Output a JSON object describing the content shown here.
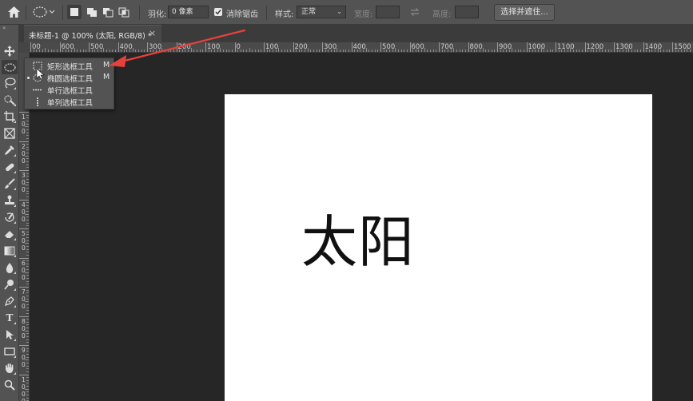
{
  "options_bar": {
    "feather_label": "羽化:",
    "feather_value": "0 像素",
    "antialias_label": "消除锯齿",
    "style_label": "样式:",
    "style_value": "正常",
    "width_label": "宽度:",
    "height_label": "高度:",
    "select_mask_label": "选择并遮住..."
  },
  "document_tab": {
    "title": "未标题-1 @ 100% (太阳, RGB/8) *",
    "close": "×"
  },
  "ruler": {
    "h_labels": [
      "00",
      "600",
      "500",
      "400",
      "300",
      "200",
      "100",
      "0",
      "100",
      "200",
      "300",
      "400",
      "500",
      "600",
      "700",
      "800",
      "900",
      "1000",
      "1100",
      "1200",
      "1300",
      "1400",
      "1500",
      "16"
    ],
    "v_labels": [
      "1\n0\n0",
      "2\n0\n0",
      "3\n0\n0",
      "4\n0\n0",
      "5\n0\n0",
      "6\n0\n0",
      "7\n0\n0",
      "8\n0\n0",
      "9\n0\n0",
      "1\n0\n0\n0"
    ]
  },
  "canvas": {
    "text": "太阳",
    "artboard_color": "#ffffff",
    "pasteboard_color": "#262626"
  },
  "flyout": {
    "items": [
      {
        "label": "矩形选框工具",
        "shortcut": "M",
        "icon": "rect-marquee-icon"
      },
      {
        "label": "椭圆选框工具",
        "shortcut": "M",
        "icon": "ellipse-marquee-icon"
      },
      {
        "label": "单行选框工具",
        "shortcut": "",
        "icon": "single-row-marquee-icon"
      },
      {
        "label": "单列选框工具",
        "shortcut": "",
        "icon": "single-column-marquee-icon"
      }
    ]
  },
  "annotation": {
    "arrow_color": "#e8413c"
  }
}
